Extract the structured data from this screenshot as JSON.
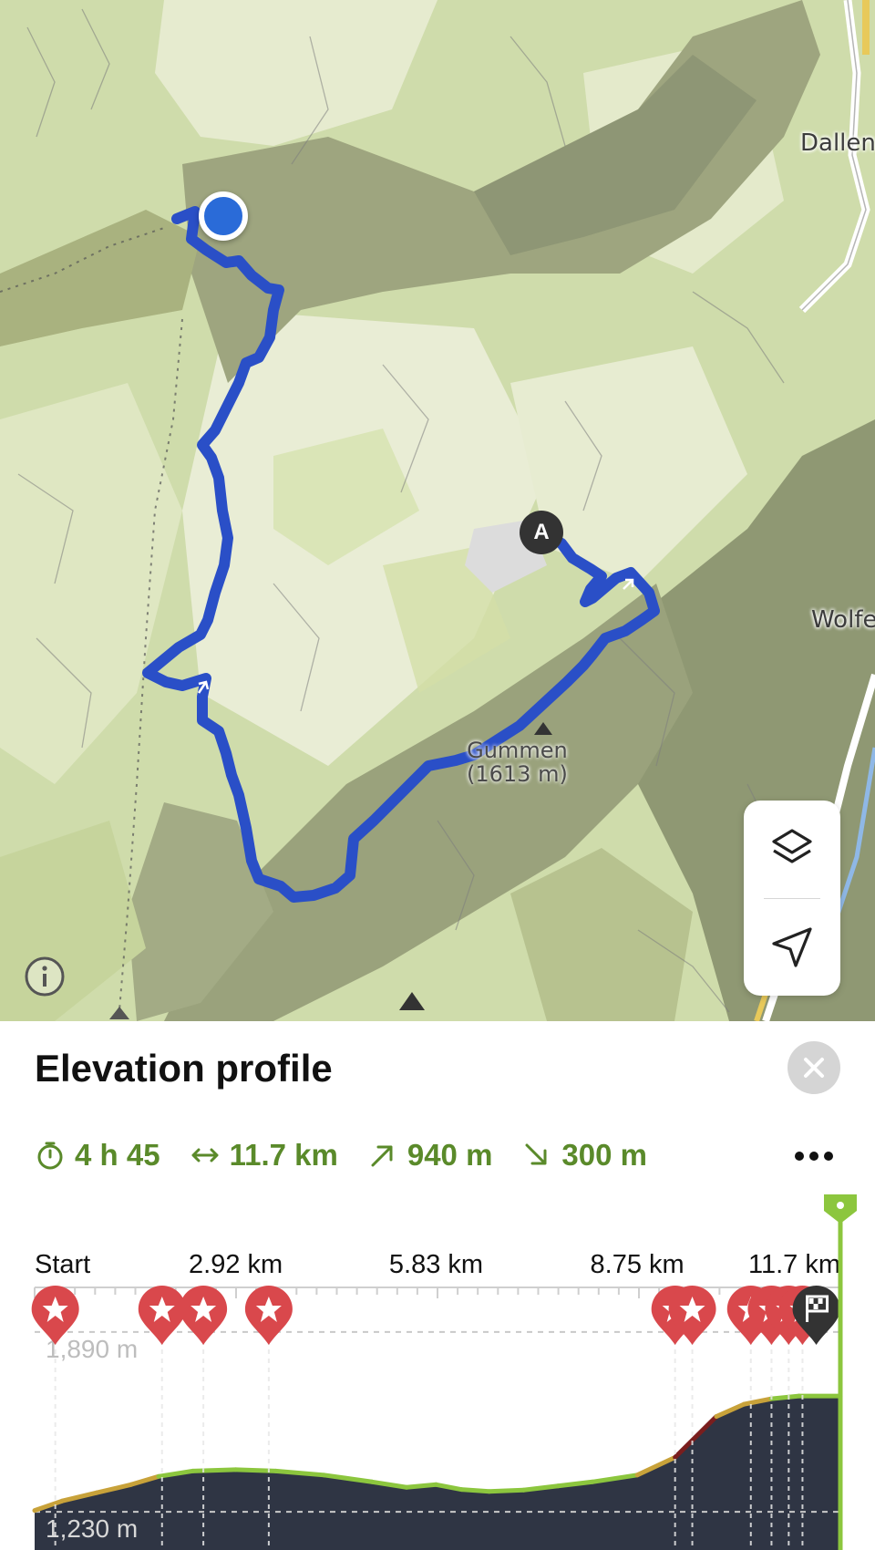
{
  "map": {
    "places": [
      {
        "name": "Dallen"
      },
      {
        "name": "Wolfe"
      }
    ],
    "peak": {
      "name": "Gummen",
      "elevation": "(1613 m)"
    },
    "waypoint_marker": "A",
    "icons": {
      "info": "info-icon",
      "layers": "layers-icon",
      "locate": "locate-arrow-icon"
    }
  },
  "panel": {
    "title": "Elevation profile",
    "stats": {
      "duration": "4 h 45",
      "distance": "11.7 km",
      "ascent": "940 m",
      "descent": "300 m"
    },
    "accent_color": "#5a8a2a"
  },
  "chart_data": {
    "type": "area",
    "x_unit": "km",
    "x_ticks": [
      "Start",
      "2.92 km",
      "5.83 km",
      "8.75 km",
      "11.7 km"
    ],
    "y_ticks": [
      "1,890 m",
      "1,230 m"
    ],
    "ylim": [
      1090,
      1960
    ],
    "xlim": [
      0,
      11.7
    ],
    "profile": {
      "x": [
        0,
        0.4,
        0.9,
        1.4,
        1.8,
        2.3,
        2.92,
        3.5,
        4.2,
        4.9,
        5.4,
        5.83,
        6.2,
        6.6,
        7.1,
        7.6,
        8.1,
        8.75,
        9.3,
        9.9,
        10.3,
        10.7,
        11.1,
        11.7
      ],
      "y": [
        1235,
        1270,
        1300,
        1330,
        1360,
        1380,
        1385,
        1380,
        1365,
        1340,
        1320,
        1330,
        1312,
        1305,
        1310,
        1325,
        1340,
        1365,
        1430,
        1580,
        1625,
        1645,
        1655,
        1655
      ]
    },
    "poi_x": [
      0.3,
      1.85,
      2.45,
      3.4,
      9.3,
      9.55,
      10.4,
      10.7,
      10.95,
      11.15
    ],
    "finish_flag_x": 11.35,
    "fill_color": "#2f3544",
    "line_color": "#8cc63e",
    "steep_color": "#7a1e1e"
  }
}
